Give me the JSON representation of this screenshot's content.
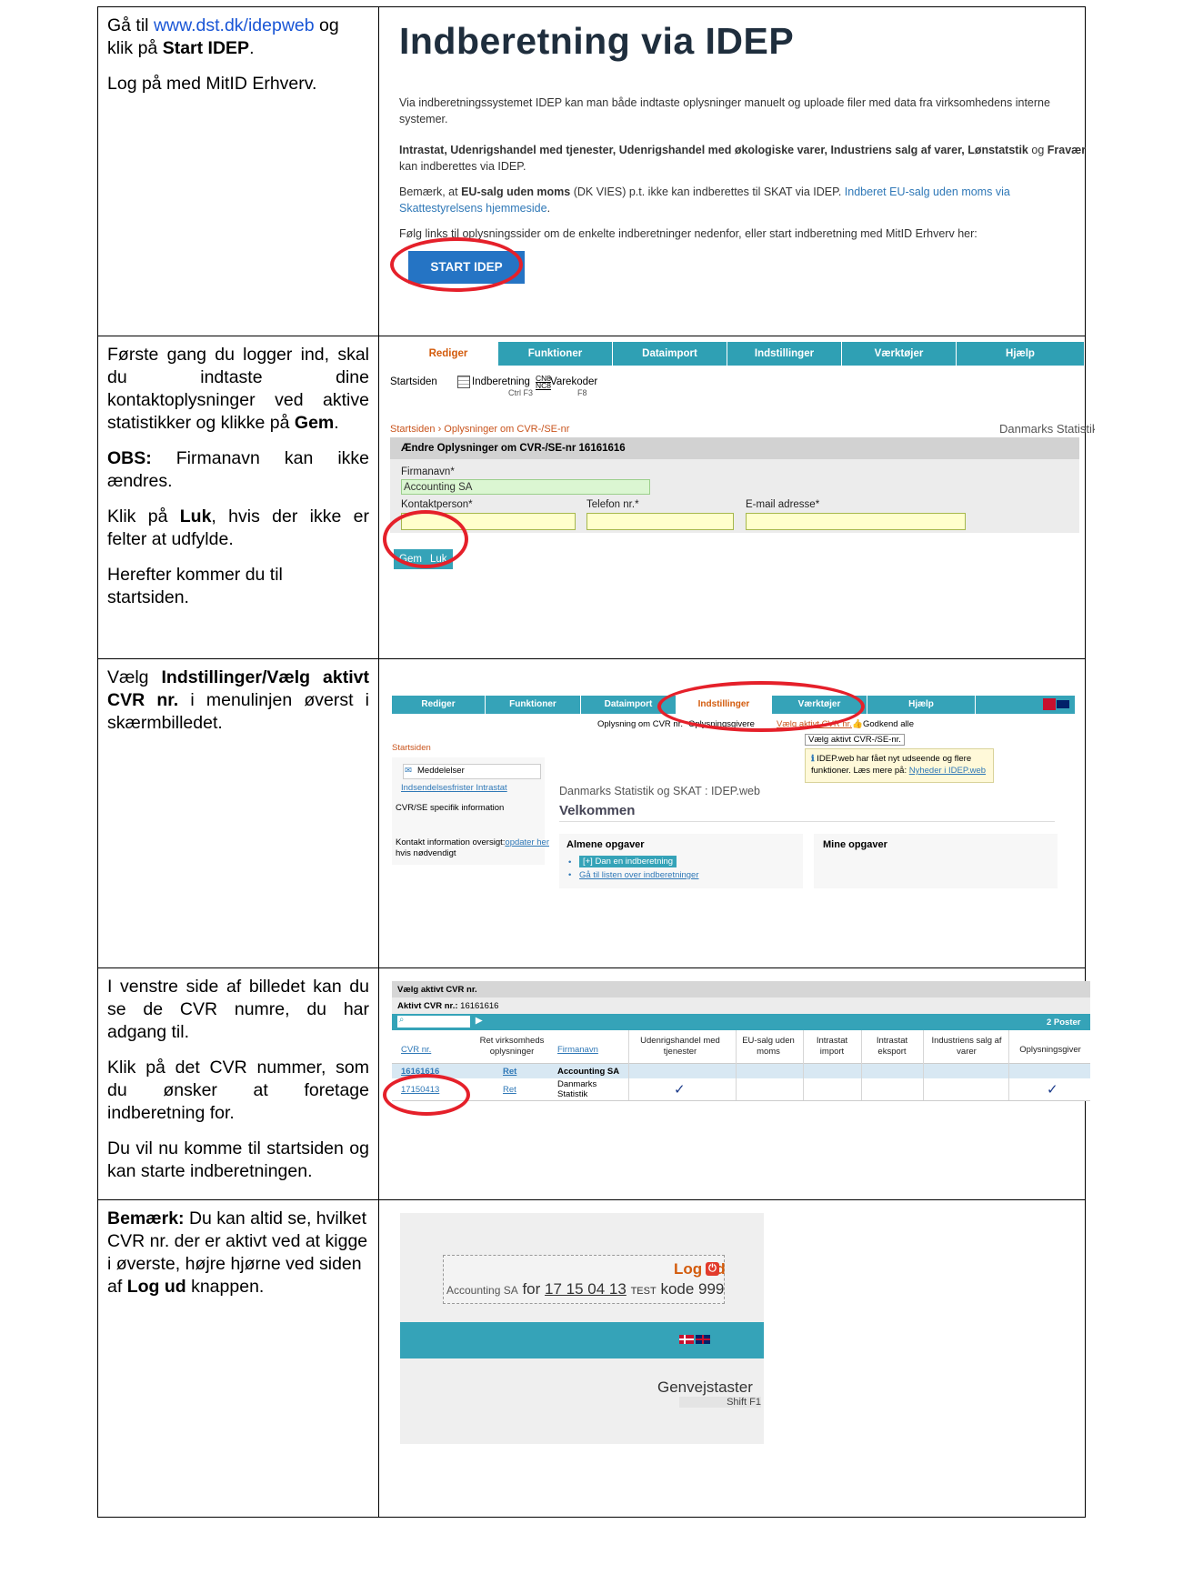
{
  "rows": [
    {
      "left": {
        "p1_pre": "Gå til ",
        "p1_link": "www.dst.dk/idepweb",
        "p1_mid": " og klik på ",
        "p1_bold": "Start IDEP",
        "p1_end": ".",
        "p2": "Log på med MitID Erhverv."
      },
      "screenshot": {
        "title": "Indberetning via IDEP",
        "para1": "Via indberetningssystemet IDEP kan man både indtaste oplysninger manuelt og uploade filer med data fra virksomhedens interne systemer.",
        "para2_bold1": "Intrastat, Udenrigshandel med tjenester, Udenrigshandel med økologiske varer, Industriens salg af varer, Lønstatstik",
        "para2_og": " og ",
        "para2_bold2": "Fravær",
        "para2_end": " kan indberettes via IDEP.",
        "para3_pre": "Bemærk, at ",
        "para3_bold": "EU-salg uden moms",
        "para3_mid": " (DK VIES) p.t. ikke kan indberettes til SKAT via IDEP. ",
        "para3_link": "Indberet EU-salg uden moms via Skattestyrelsens hjemmeside",
        "para3_end": ".",
        "para4": "Følg links til oplysningssider om de enkelte indberetninger nedenfor, eller start indberetning med MitID Erhverv her:",
        "button": "START IDEP"
      }
    },
    {
      "left": {
        "p1_pre": "Første gang du logger ind, skal du indtaste dine kontaktoplysninger ved aktive statistikker og klikke på ",
        "p1_bold": "Gem",
        "p1_end": ".",
        "p2_bold": "OBS:",
        "p2": " Firmanavn kan ikke ændres.",
        "p3_pre": "Klik på ",
        "p3_bold": "Luk",
        "p3_end": ", hvis der ikke er felter at udfylde.",
        "p4": "Herefter kommer du til startsiden."
      },
      "screenshot": {
        "tabs": [
          "Rediger",
          "Funktioner",
          "Dataimport",
          "Indstillinger",
          "Værktøjer",
          "Hjælp"
        ],
        "toolbar_start": "Startsiden",
        "toolbar_ind": "Indberetning",
        "toolbar_ind_key": "Ctrl F3",
        "toolbar_cn": "CN8\nNC8",
        "toolbar_vare": "Varekoder",
        "toolbar_vare_key": "F8",
        "breadcrumb": "Startsiden › Oplysninger om CVR-/SE-nr",
        "org": "Danmarks Statistik",
        "form_title": "Ændre Oplysninger om CVR-/SE-nr 16161616",
        "firmanavn_label": "Firmanavn*",
        "firmanavn_value": "Accounting SA",
        "kontakt_label": "Kontaktperson*",
        "telefon_label": "Telefon nr.*",
        "email_label": "E-mail adresse*",
        "gem": "Gem",
        "luk": "Luk"
      }
    },
    {
      "left": {
        "p1_pre": "Vælg ",
        "p1_bold": "Indstillinger/Vælg aktivt CVR nr.",
        "p1_end": " i menulinjen øverst i skærmbilledet."
      },
      "screenshot": {
        "tabs": [
          "Rediger",
          "Funktioner",
          "Dataimport",
          "Indstillinger",
          "Værktøjer",
          "Hjælp"
        ],
        "sub1": "Oplysning om CVR nr.",
        "sub2": "Oplysningsgivere",
        "sub3": "Vælg aktivt CVR nr.",
        "sub4": "Godkend alle",
        "tooltip_small": "Vælg aktivt CVR-/SE-nr.",
        "startsiden": "Startsiden",
        "meddelelser": "Meddelelser",
        "frister": "Indsendelsesfrister Intrastat",
        "cvr_info": "CVR/SE specifik information",
        "kontakt_pre": "Kontakt information oversigt:",
        "kontakt_link": "opdater her",
        "kontakt_end": " hvis nødvendigt",
        "app_title": "Danmarks Statistik og SKAT : IDEP.web",
        "velkommen": "Velkommen",
        "info_text": "IDEP.web har fået nyt udseende og flere funktioner. Læs mere på: ",
        "info_link": "Nyheder i IDEP.web",
        "almene": "Almene opgaver",
        "dan_en": "[+] Dan en indberetning",
        "gaa_til": "Gå til listen over indberetninger",
        "mine": "Mine opgaver"
      }
    },
    {
      "left": {
        "p1": "I venstre side af billedet kan du se de CVR numre, du har adgang til.",
        "p2": "Klik på det CVR nummer, som du ønsker at foretage indberetning for.",
        "p3": "Du vil nu komme til startsiden og kan starte indberetningen."
      },
      "screenshot": {
        "title": "Vælg aktivt CVR nr.",
        "aktiv_label": "Aktivt CVR nr.:",
        "aktiv_value": "16161616",
        "poster": "2 Poster",
        "headers": [
          "CVR nr.",
          "Ret virksomheds oplysninger",
          "Firmanavn",
          "Udenrigshandel med tjenester",
          "EU-salg uden moms",
          "Intrastat import",
          "Intrastat eksport",
          "Industriens salg af varer",
          "Oplysningsgiver"
        ],
        "rows": [
          {
            "cvr": "16161616",
            "ret": "Ret",
            "firma": "Accounting SA"
          },
          {
            "cvr": "17150413",
            "ret": "Ret",
            "firma": "Danmarks Statistik"
          }
        ],
        "check": "✓"
      }
    },
    {
      "left": {
        "p1_bold": "Bemærk:",
        "p1_mid": " Du kan altid se, hvilket CVR nr. der er aktivt ved at kigge i øverste, højre hjørne ved siden af ",
        "p1_bold2": "Log ud",
        "p1_end": " knappen."
      },
      "screenshot": {
        "logud": "Log ud",
        "company": "Accounting SA",
        "for": "for",
        "cvr": "17 15 04 13",
        "test": "TEST",
        "kode": "kode 999",
        "genvej": "Genvejstaster",
        "shift": "Shift F1"
      }
    }
  ],
  "colors": {
    "accent": "#35a3b8",
    "orange": "#d35b0c",
    "ring": "#e5202a",
    "link": "#1a56d6"
  }
}
